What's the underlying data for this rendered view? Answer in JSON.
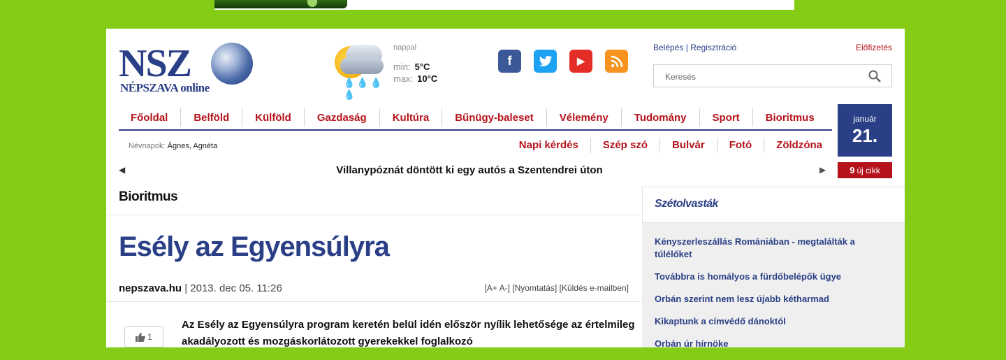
{
  "logo": {
    "main": "NSZ",
    "sub": "NÉPSZAVA",
    "sub_suffix": "online"
  },
  "weather": {
    "period": "nappal",
    "min_label": "min:",
    "min_value": "5°C",
    "max_label": "max:",
    "max_value": "10°C",
    "icon": "sun-cloud-rain-icon"
  },
  "social": {
    "facebook": "f",
    "twitter": "t",
    "youtube": "▶",
    "rss": "rss"
  },
  "account": {
    "login": "Belépés",
    "separator": "|",
    "register": "Regisztráció",
    "subscribe": "Előfizetés"
  },
  "search": {
    "placeholder": "Keresés"
  },
  "nav": [
    "Főoldal",
    "Belföld",
    "Külföld",
    "Gazdaság",
    "Kultúra",
    "Bűnügy-baleset",
    "Vélemény",
    "Tudomány",
    "Sport",
    "Bioritmus"
  ],
  "date": {
    "month": "január",
    "day": "21."
  },
  "nameday": {
    "label": "Névnapok:",
    "names": "Ágnes, Agnéta"
  },
  "subnav": [
    "Napi kérdés",
    "Szép szó",
    "Bulvár",
    "Fotó",
    "Zöldzóna"
  ],
  "ticker": {
    "left": "◀",
    "text": "Villanypóznát döntött ki egy autós a Szentendrei úton",
    "right": "▶"
  },
  "new_articles": {
    "count": "9",
    "label": "új cikk"
  },
  "article": {
    "section": "Bioritmus",
    "title": "Esély az Egyensúlyra",
    "source": "nepszava.hu",
    "separator": "|",
    "date": "2013. dec 05. 11:26",
    "tools": "[A+ A-] [Nyomtatás] [Küldés e-mailben]",
    "likes": "1",
    "lead": "Az Esély az Egyensúlyra program keretén belül idén először nyílik lehetősége az értelmileg akadályozott és mozgáskorlátozott gyerekekkel foglalkozó"
  },
  "sidebar": {
    "title": "Szétolvasták",
    "items": [
      "Kényszerleszállás Romániában - megtalálták a túlélőket",
      "Továbbra is homályos a fürdőbelépők ügye",
      "Orbán szerint nem lesz újabb kétharmad",
      "Kikaptunk a címvédő dánoktól",
      "Orbán úr hírnöke"
    ]
  },
  "colors": {
    "background": "#84cc16",
    "brand_blue": "#2a3f86",
    "brand_red": "#b5121b"
  }
}
